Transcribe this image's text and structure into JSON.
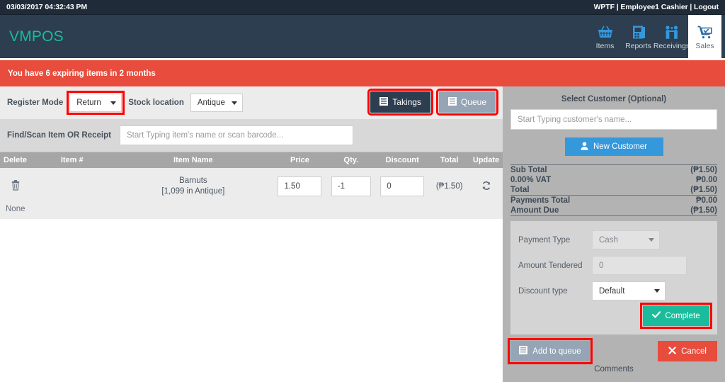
{
  "topbar": {
    "timestamp": "03/03/2017 04:32:43 PM",
    "user_info": "WPTF | Employee1 Cashier | Logout"
  },
  "header": {
    "brand": "VMPOS",
    "nav": [
      {
        "label": "Items",
        "icon": "basket-icon",
        "active": false
      },
      {
        "label": "Reports",
        "icon": "report-document-icon",
        "active": false
      },
      {
        "label": "Receivings",
        "icon": "people-icon",
        "active": false
      },
      {
        "label": "Sales",
        "icon": "shopping-cart-check-icon",
        "active": true
      }
    ]
  },
  "alert": {
    "message": "You have 6 expiring items in 2 months",
    "color": "#e74c3c"
  },
  "register": {
    "mode_label": "Register Mode",
    "mode_value": "Return",
    "stock_label": "Stock location",
    "stock_value": "Antique",
    "takings_label": "Takings",
    "queue_label": "Queue"
  },
  "find": {
    "label": "Find/Scan Item OR Receipt",
    "placeholder": "Start Typing item's name or scan barcode..."
  },
  "table": {
    "columns": [
      "Delete",
      "Item #",
      "Item Name",
      "Price",
      "Qty.",
      "Discount",
      "Total",
      "Update"
    ],
    "row": {
      "item_number": "",
      "item_name": "Barnuts",
      "item_stock": "[1,099 in Antique]",
      "price": "1.50",
      "qty": "-1",
      "discount": "0",
      "total": "(₱1.50)"
    },
    "footer_note": "None"
  },
  "customer": {
    "title": "Select Customer (Optional)",
    "placeholder": "Start Typing customer's name...",
    "new_customer_label": "New Customer"
  },
  "totals": [
    {
      "label": "Sub Total",
      "value": "(₱1.50)"
    },
    {
      "label": "0.00% VAT",
      "value": "₱0.00"
    },
    {
      "label": "Total",
      "value": "(₱1.50)"
    },
    {
      "label": "Payments Total",
      "value": "₱0.00"
    },
    {
      "label": "Amount Due",
      "value": "(₱1.50)"
    }
  ],
  "payment": {
    "type_label": "Payment Type",
    "type_value": "Cash",
    "tendered_label": "Amount Tendered",
    "tendered_value": "0",
    "discount_label": "Discount type",
    "discount_value": "Default",
    "complete_label": "Complete",
    "add_queue_label": "Add to queue",
    "cancel_label": "Cancel",
    "comments_label": "Comments"
  },
  "colors": {
    "brand": "#1abc9c",
    "header_bg": "#2c3e50",
    "alert": "#e74c3c",
    "accent_blue": "#3498db",
    "highlight": "#ff0000"
  }
}
